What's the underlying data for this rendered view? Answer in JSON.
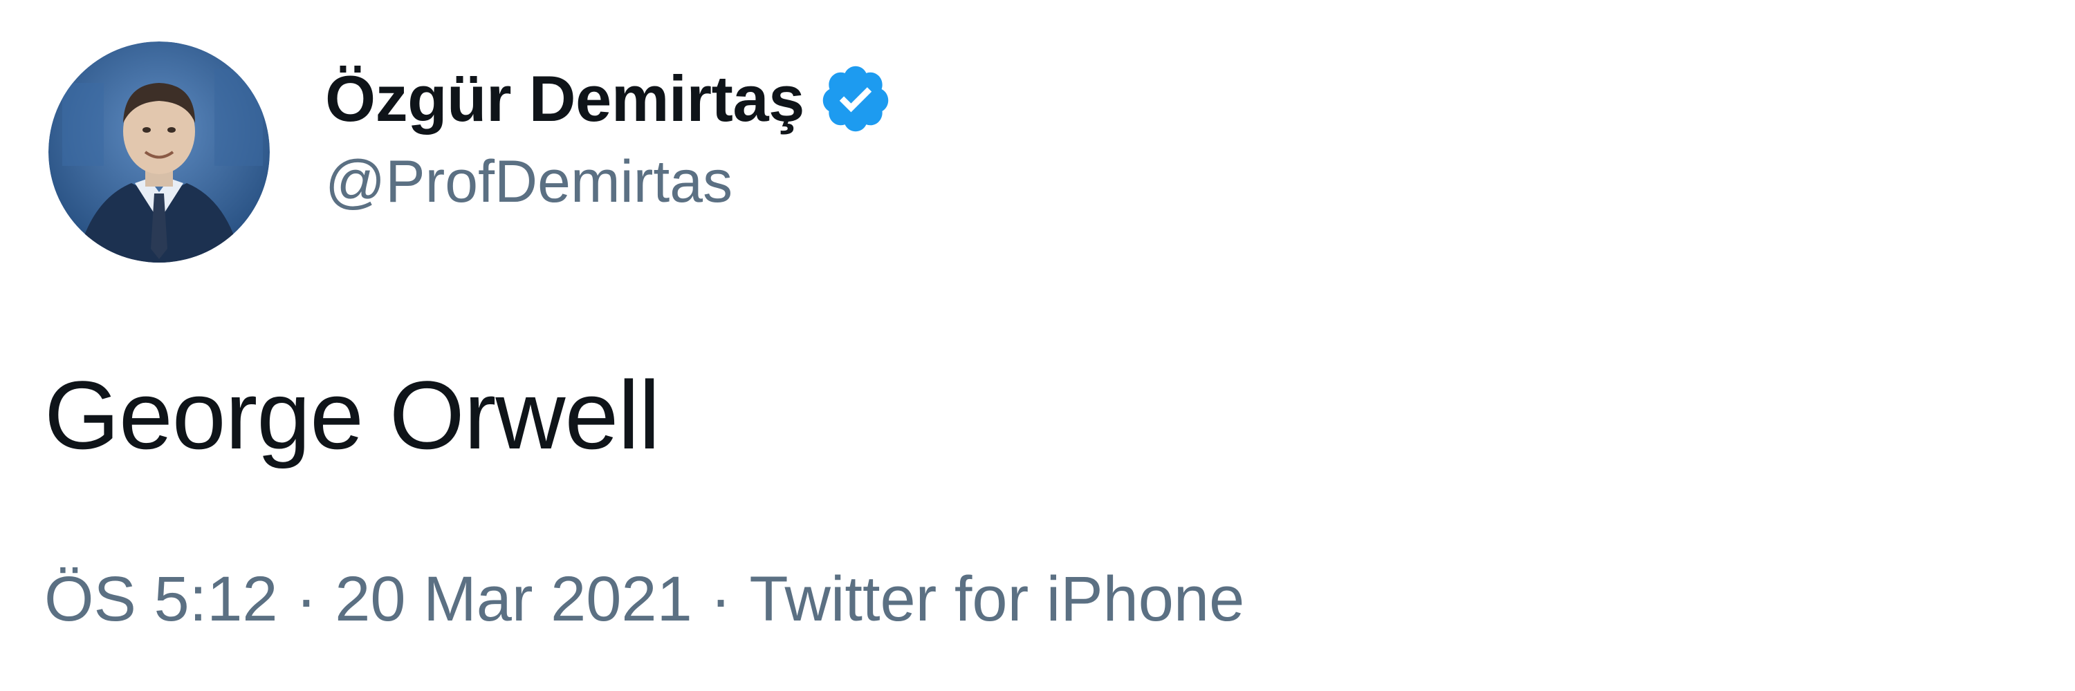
{
  "author": {
    "display_name": "Özgür Demirtaş",
    "handle": "@ProfDemirtas",
    "verified": true,
    "avatar_icon": "profile-photo"
  },
  "tweet": {
    "text": "George Orwell"
  },
  "meta": {
    "time": "ÖS 5:12",
    "separator": "·",
    "date": "20 Mar 2021",
    "source": "Twitter for iPhone"
  },
  "colors": {
    "verified_blue": "#1d9bf0",
    "secondary_text": "#5b7083",
    "primary_text": "#0f1419",
    "avatar_bg": "#2f5f96"
  }
}
